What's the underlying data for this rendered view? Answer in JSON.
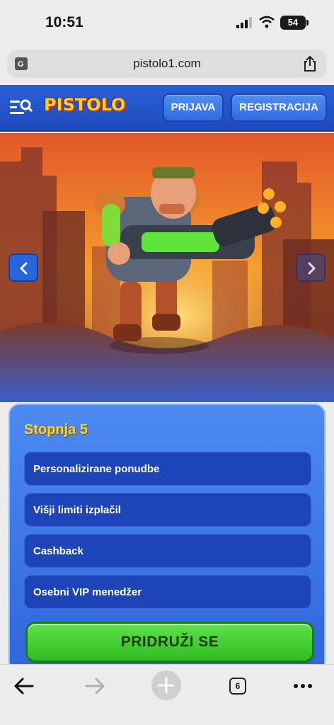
{
  "status_bar": {
    "time": "10:51",
    "battery": "54"
  },
  "browser": {
    "url": "pistolo1.com"
  },
  "header": {
    "logo": "PISTOLO",
    "login_label": "PRIJAVA",
    "register_label": "REGISTRACIJA"
  },
  "level_card": {
    "title": "Stopnja 5",
    "benefits": [
      "Personalizirane ponudbe",
      "Višji limiti izplačil",
      "Cashback",
      "Osebni VIP menedžer"
    ],
    "join_label": "PRIDRUŽI SE"
  },
  "toolbar": {
    "tab_count": "6"
  },
  "colors": {
    "header_blue": "#2a5fd6",
    "card_blue": "#3a74e6",
    "title_yellow": "#ffd21f",
    "join_green": "#3fcf2e"
  },
  "icons": [
    "translate-icon",
    "share-icon",
    "menu-search-icon",
    "chevron-left-icon",
    "chevron-right-icon",
    "back-arrow-icon",
    "forward-arrow-icon",
    "plus-icon",
    "tabs-icon",
    "more-icon"
  ]
}
